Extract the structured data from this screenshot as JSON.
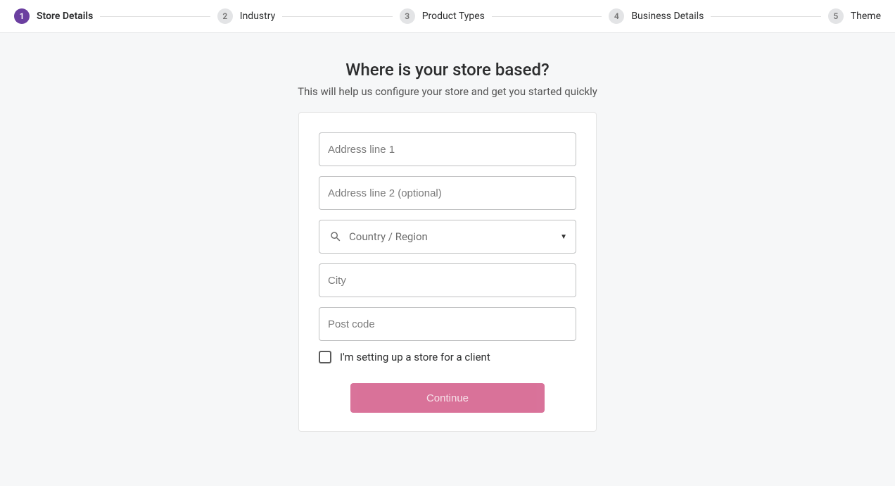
{
  "stepper": [
    {
      "number": "1",
      "label": "Store Details",
      "active": true
    },
    {
      "number": "2",
      "label": "Industry",
      "active": false
    },
    {
      "number": "3",
      "label": "Product Types",
      "active": false
    },
    {
      "number": "4",
      "label": "Business Details",
      "active": false
    },
    {
      "number": "5",
      "label": "Theme",
      "active": false
    }
  ],
  "heading": "Where is your store based?",
  "subheading": "This will help us configure your store and get you started quickly",
  "fields": {
    "address1_placeholder": "Address line 1",
    "address2_placeholder": "Address line 2 (optional)",
    "country_label": "Country / Region",
    "city_placeholder": "City",
    "postcode_placeholder": "Post code"
  },
  "checkbox_label": "I'm setting up a store for a client",
  "continue_label": "Continue"
}
